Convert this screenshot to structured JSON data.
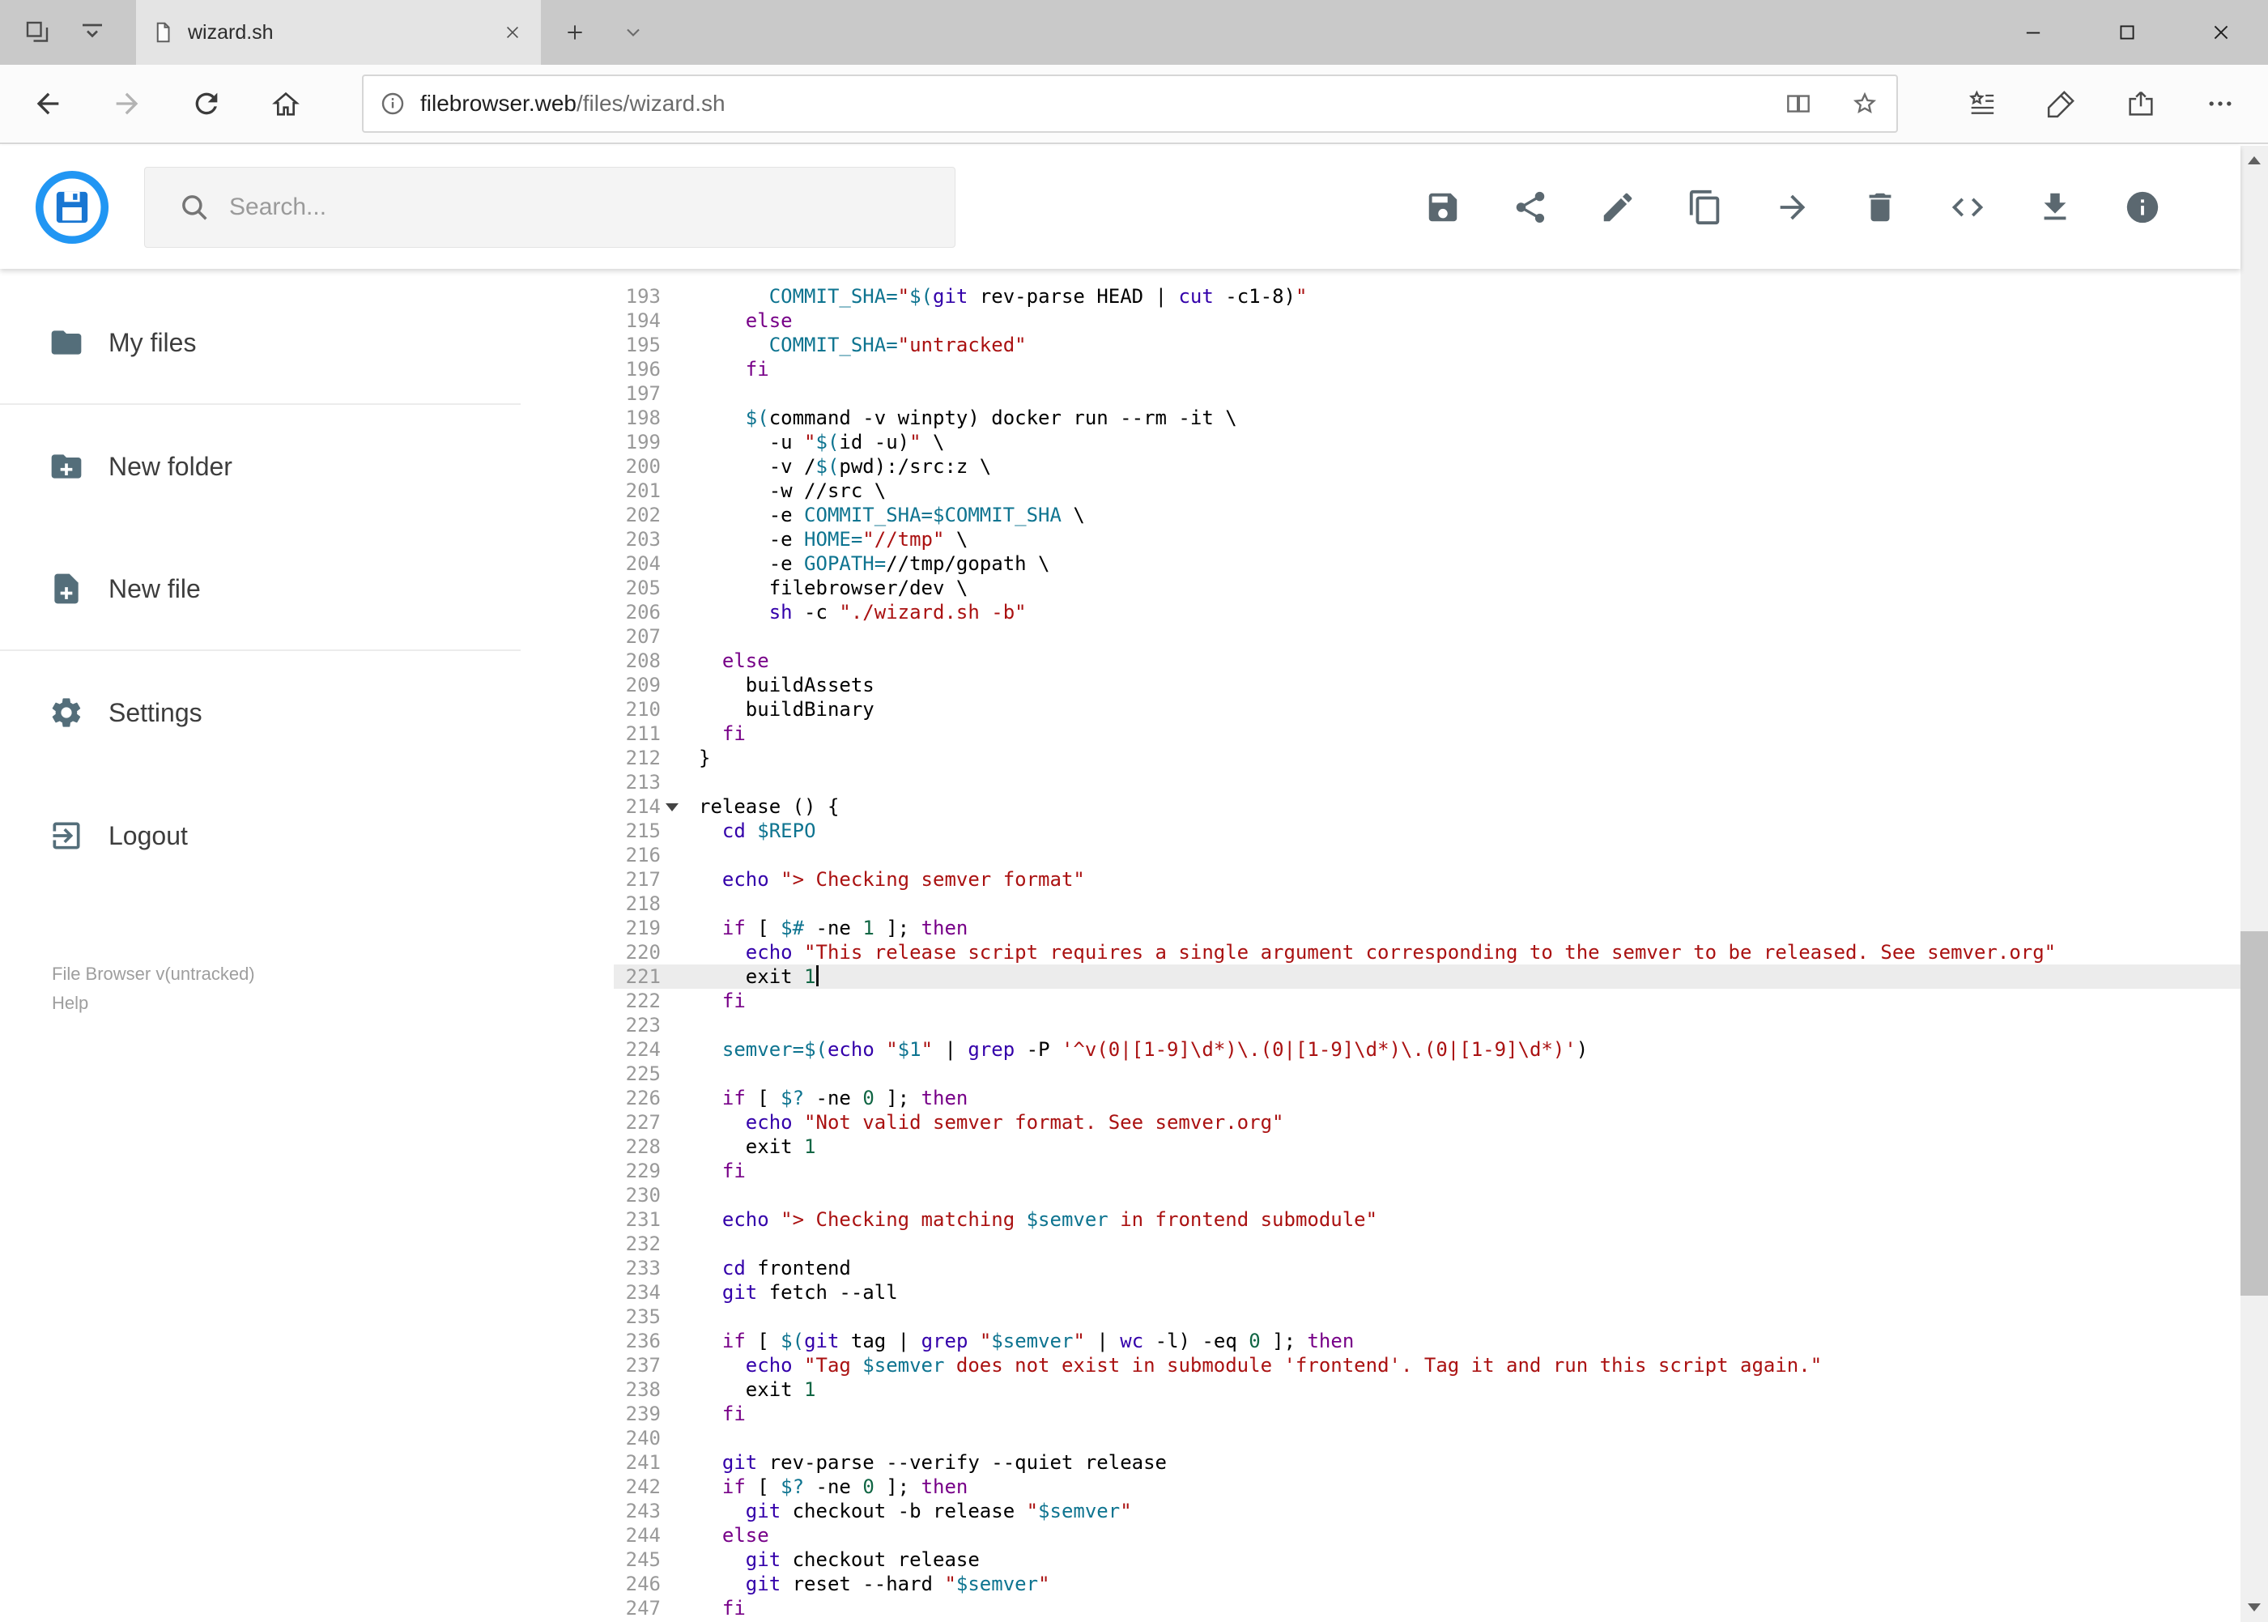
{
  "browser": {
    "tab": {
      "title": "wizard.sh",
      "favicon": "page-icon",
      "close_icon": "close-icon"
    },
    "tab_strip_icons": [
      "set-tabs-aside-icon",
      "tab-preview-toggle-icon"
    ],
    "new_tab_icon": "plus-icon",
    "tab_list_icon": "chevron-down-icon",
    "window_controls": [
      "minimize-icon",
      "maximize-icon",
      "close-icon"
    ],
    "nav_icons": [
      "back-icon",
      "forward-icon",
      "refresh-icon",
      "home-icon"
    ],
    "address": {
      "domain": "filebrowser.web",
      "path": "/files/wizard.sh",
      "left_icon": "page-info-icon",
      "right_icons": [
        "reading-view-icon",
        "favorite-star-icon"
      ]
    },
    "right_action_icons": [
      "hub-favorites-icon",
      "web-notes-pen-icon",
      "share-page-icon",
      "more-options-icon"
    ]
  },
  "header": {
    "logo_icon": "filebrowser-logo",
    "search": {
      "placeholder": "Search...",
      "icon": "search-icon"
    },
    "actions": [
      "save-icon",
      "share-icon",
      "rename-icon",
      "copy-icon",
      "move-icon",
      "delete-icon",
      "raw-view-icon",
      "download-icon",
      "info-icon"
    ]
  },
  "sidebar": {
    "items": [
      {
        "id": "my-files",
        "label": "My files",
        "icon": "folder-icon",
        "divider_below": true
      },
      {
        "id": "new-folder",
        "label": "New folder",
        "icon": "folder-plus-icon",
        "divider_below": false
      },
      {
        "id": "new-file",
        "label": "New file",
        "icon": "file-plus-icon",
        "divider_below": true
      },
      {
        "id": "settings",
        "label": "Settings",
        "icon": "gear-icon",
        "divider_below": false
      },
      {
        "id": "logout",
        "label": "Logout",
        "icon": "logout-icon",
        "divider_below": false
      }
    ],
    "footer": {
      "version": "File Browser v(untracked)",
      "help": "Help"
    }
  },
  "editor": {
    "language": "shell",
    "first_visible_line": 193,
    "last_visible_line": 247,
    "active_line": 221,
    "fold_marker_line": 214,
    "colors": {
      "keyword": "#770088",
      "builtin": "#3300aa",
      "string": "#aa1111",
      "variable": "#0e7490",
      "number": "#116644",
      "text": "#000000",
      "line_number": "#999999",
      "active_line_bg": "#ececec"
    },
    "lines": [
      {
        "n": 193,
        "t": [
          [
            "p",
            "      "
          ],
          [
            "v",
            "COMMIT_SHA="
          ],
          [
            "s",
            "\""
          ],
          [
            "v",
            "$("
          ],
          [
            "b",
            "git"
          ],
          [
            "p",
            " rev-parse HEAD | "
          ],
          [
            "b",
            "cut"
          ],
          [
            "p",
            " -c1-8)"
          ],
          [
            "s",
            "\""
          ]
        ]
      },
      {
        "n": 194,
        "t": [
          [
            "p",
            "    "
          ],
          [
            "k",
            "else"
          ]
        ]
      },
      {
        "n": 195,
        "t": [
          [
            "p",
            "      "
          ],
          [
            "v",
            "COMMIT_SHA="
          ],
          [
            "s",
            "\"untracked\""
          ]
        ]
      },
      {
        "n": 196,
        "t": [
          [
            "p",
            "    "
          ],
          [
            "k",
            "fi"
          ]
        ]
      },
      {
        "n": 197,
        "t": []
      },
      {
        "n": 198,
        "t": [
          [
            "p",
            "    "
          ],
          [
            "v",
            "$("
          ],
          [
            "p",
            "command -v winpty) docker run --rm -it \\"
          ]
        ]
      },
      {
        "n": 199,
        "t": [
          [
            "p",
            "      -u "
          ],
          [
            "s",
            "\""
          ],
          [
            "v",
            "$("
          ],
          [
            "p",
            "id -u)"
          ],
          [
            "s",
            "\""
          ],
          [
            "p",
            " \\"
          ]
        ]
      },
      {
        "n": 200,
        "t": [
          [
            "p",
            "      -v /"
          ],
          [
            "v",
            "$("
          ],
          [
            "p",
            "pwd):/src:z \\"
          ]
        ]
      },
      {
        "n": 201,
        "t": [
          [
            "p",
            "      -w //src \\"
          ]
        ]
      },
      {
        "n": 202,
        "t": [
          [
            "p",
            "      -e "
          ],
          [
            "v",
            "COMMIT_SHA=$COMMIT_SHA"
          ],
          [
            "p",
            " \\"
          ]
        ]
      },
      {
        "n": 203,
        "t": [
          [
            "p",
            "      -e "
          ],
          [
            "v",
            "HOME="
          ],
          [
            "s",
            "\"//tmp\""
          ],
          [
            "p",
            " \\"
          ]
        ]
      },
      {
        "n": 204,
        "t": [
          [
            "p",
            "      -e "
          ],
          [
            "v",
            "GOPATH="
          ],
          [
            "p",
            "//tmp/gopath \\"
          ]
        ]
      },
      {
        "n": 205,
        "t": [
          [
            "p",
            "      filebrowser/dev \\"
          ]
        ]
      },
      {
        "n": 206,
        "t": [
          [
            "p",
            "      "
          ],
          [
            "b",
            "sh"
          ],
          [
            "p",
            " -c "
          ],
          [
            "s",
            "\"./wizard.sh -b\""
          ]
        ]
      },
      {
        "n": 207,
        "t": []
      },
      {
        "n": 208,
        "t": [
          [
            "p",
            "  "
          ],
          [
            "k",
            "else"
          ]
        ]
      },
      {
        "n": 209,
        "t": [
          [
            "p",
            "    buildAssets"
          ]
        ]
      },
      {
        "n": 210,
        "t": [
          [
            "p",
            "    buildBinary"
          ]
        ]
      },
      {
        "n": 211,
        "t": [
          [
            "p",
            "  "
          ],
          [
            "k",
            "fi"
          ]
        ]
      },
      {
        "n": 212,
        "t": [
          [
            "p",
            "}"
          ]
        ]
      },
      {
        "n": 213,
        "t": []
      },
      {
        "n": 214,
        "t": [
          [
            "p",
            "release () {"
          ]
        ]
      },
      {
        "n": 215,
        "t": [
          [
            "p",
            "  "
          ],
          [
            "b",
            "cd"
          ],
          [
            "p",
            " "
          ],
          [
            "v",
            "$REPO"
          ]
        ]
      },
      {
        "n": 216,
        "t": []
      },
      {
        "n": 217,
        "t": [
          [
            "p",
            "  "
          ],
          [
            "b",
            "echo"
          ],
          [
            "p",
            " "
          ],
          [
            "s",
            "\"> Checking semver format\""
          ]
        ]
      },
      {
        "n": 218,
        "t": []
      },
      {
        "n": 219,
        "t": [
          [
            "p",
            "  "
          ],
          [
            "k",
            "if"
          ],
          [
            "p",
            " [ "
          ],
          [
            "v",
            "$#"
          ],
          [
            "p",
            " -ne "
          ],
          [
            "n",
            "1"
          ],
          [
            "p",
            " ]; "
          ],
          [
            "k",
            "then"
          ]
        ]
      },
      {
        "n": 220,
        "t": [
          [
            "p",
            "    "
          ],
          [
            "b",
            "echo"
          ],
          [
            "p",
            " "
          ],
          [
            "s",
            "\"This release script requires a single argument corresponding to the semver to be released. See semver.org\""
          ]
        ]
      },
      {
        "n": 221,
        "t": [
          [
            "p",
            "    exit "
          ],
          [
            "n",
            "1"
          ]
        ]
      },
      {
        "n": 222,
        "t": [
          [
            "p",
            "  "
          ],
          [
            "k",
            "fi"
          ]
        ]
      },
      {
        "n": 223,
        "t": []
      },
      {
        "n": 224,
        "t": [
          [
            "p",
            "  "
          ],
          [
            "v",
            "semver="
          ],
          [
            "v",
            "$("
          ],
          [
            "b",
            "echo"
          ],
          [
            "p",
            " "
          ],
          [
            "s",
            "\""
          ],
          [
            "v",
            "$1"
          ],
          [
            "s",
            "\""
          ],
          [
            "p",
            " | "
          ],
          [
            "b",
            "grep"
          ],
          [
            "p",
            " -P "
          ],
          [
            "s",
            "'^v(0|[1-9]\\d*)\\.(0|[1-9]\\d*)\\.(0|[1-9]\\d*)'"
          ],
          [
            "p",
            ")"
          ]
        ]
      },
      {
        "n": 225,
        "t": []
      },
      {
        "n": 226,
        "t": [
          [
            "p",
            "  "
          ],
          [
            "k",
            "if"
          ],
          [
            "p",
            " [ "
          ],
          [
            "v",
            "$?"
          ],
          [
            "p",
            " -ne "
          ],
          [
            "n",
            "0"
          ],
          [
            "p",
            " ]; "
          ],
          [
            "k",
            "then"
          ]
        ]
      },
      {
        "n": 227,
        "t": [
          [
            "p",
            "    "
          ],
          [
            "b",
            "echo"
          ],
          [
            "p",
            " "
          ],
          [
            "s",
            "\"Not valid semver format. See semver.org\""
          ]
        ]
      },
      {
        "n": 228,
        "t": [
          [
            "p",
            "    exit "
          ],
          [
            "n",
            "1"
          ]
        ]
      },
      {
        "n": 229,
        "t": [
          [
            "p",
            "  "
          ],
          [
            "k",
            "fi"
          ]
        ]
      },
      {
        "n": 230,
        "t": []
      },
      {
        "n": 231,
        "t": [
          [
            "p",
            "  "
          ],
          [
            "b",
            "echo"
          ],
          [
            "p",
            " "
          ],
          [
            "s",
            "\"> Checking matching "
          ],
          [
            "v",
            "$semver"
          ],
          [
            "s",
            " in frontend submodule\""
          ]
        ]
      },
      {
        "n": 232,
        "t": []
      },
      {
        "n": 233,
        "t": [
          [
            "p",
            "  "
          ],
          [
            "b",
            "cd"
          ],
          [
            "p",
            " frontend"
          ]
        ]
      },
      {
        "n": 234,
        "t": [
          [
            "p",
            "  "
          ],
          [
            "b",
            "git"
          ],
          [
            "p",
            " fetch --all"
          ]
        ]
      },
      {
        "n": 235,
        "t": []
      },
      {
        "n": 236,
        "t": [
          [
            "p",
            "  "
          ],
          [
            "k",
            "if"
          ],
          [
            "p",
            " [ "
          ],
          [
            "v",
            "$("
          ],
          [
            "b",
            "git"
          ],
          [
            "p",
            " tag | "
          ],
          [
            "b",
            "grep"
          ],
          [
            "p",
            " "
          ],
          [
            "s",
            "\""
          ],
          [
            "v",
            "$semver"
          ],
          [
            "s",
            "\""
          ],
          [
            "p",
            " | "
          ],
          [
            "b",
            "wc"
          ],
          [
            "p",
            " -l) -eq "
          ],
          [
            "n",
            "0"
          ],
          [
            "p",
            " ]; "
          ],
          [
            "k",
            "then"
          ]
        ]
      },
      {
        "n": 237,
        "t": [
          [
            "p",
            "    "
          ],
          [
            "b",
            "echo"
          ],
          [
            "p",
            " "
          ],
          [
            "s",
            "\"Tag "
          ],
          [
            "v",
            "$semver"
          ],
          [
            "s",
            " does not exist in submodule 'frontend'. Tag it and run this script again.\""
          ]
        ]
      },
      {
        "n": 238,
        "t": [
          [
            "p",
            "    exit "
          ],
          [
            "n",
            "1"
          ]
        ]
      },
      {
        "n": 239,
        "t": [
          [
            "p",
            "  "
          ],
          [
            "k",
            "fi"
          ]
        ]
      },
      {
        "n": 240,
        "t": []
      },
      {
        "n": 241,
        "t": [
          [
            "p",
            "  "
          ],
          [
            "b",
            "git"
          ],
          [
            "p",
            " rev-parse --verify --quiet release"
          ]
        ]
      },
      {
        "n": 242,
        "t": [
          [
            "p",
            "  "
          ],
          [
            "k",
            "if"
          ],
          [
            "p",
            " [ "
          ],
          [
            "v",
            "$?"
          ],
          [
            "p",
            " -ne "
          ],
          [
            "n",
            "0"
          ],
          [
            "p",
            " ]; "
          ],
          [
            "k",
            "then"
          ]
        ]
      },
      {
        "n": 243,
        "t": [
          [
            "p",
            "    "
          ],
          [
            "b",
            "git"
          ],
          [
            "p",
            " checkout -b release "
          ],
          [
            "s",
            "\""
          ],
          [
            "v",
            "$semver"
          ],
          [
            "s",
            "\""
          ]
        ]
      },
      {
        "n": 244,
        "t": [
          [
            "p",
            "  "
          ],
          [
            "k",
            "else"
          ]
        ]
      },
      {
        "n": 245,
        "t": [
          [
            "p",
            "    "
          ],
          [
            "b",
            "git"
          ],
          [
            "p",
            " checkout release"
          ]
        ]
      },
      {
        "n": 246,
        "t": [
          [
            "p",
            "    "
          ],
          [
            "b",
            "git"
          ],
          [
            "p",
            " reset --hard "
          ],
          [
            "s",
            "\""
          ],
          [
            "v",
            "$semver"
          ],
          [
            "s",
            "\""
          ]
        ]
      },
      {
        "n": 247,
        "t": [
          [
            "p",
            "  "
          ],
          [
            "k",
            "fi"
          ]
        ]
      }
    ]
  }
}
